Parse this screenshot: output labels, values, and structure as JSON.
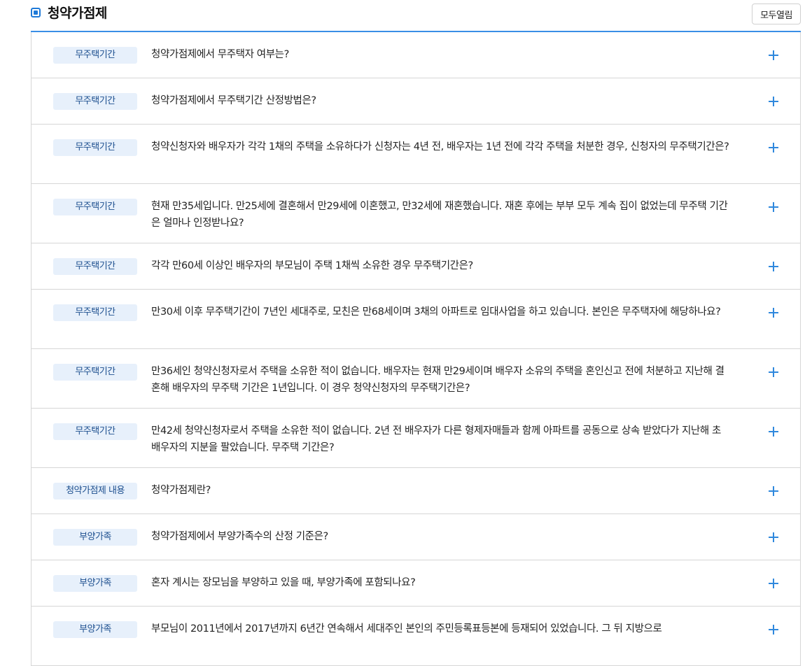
{
  "header": {
    "title": "청약가점제",
    "open_all_label": "모두열림"
  },
  "faq": [
    {
      "category": "무주택기간",
      "question": "청약가점제에서 무주택자 여부는?"
    },
    {
      "category": "무주택기간",
      "question": "청약가점제에서 무주택기간 산정방법은?"
    },
    {
      "category": "무주택기간",
      "question": "청약신청자와 배우자가 각각 1채의 주택을 소유하다가 신청자는 4년 전, 배우자는 1년 전에 각각 주택을 처분한 경우, 신청자의 무주택기간은?"
    },
    {
      "category": "무주택기간",
      "question": "현재 만35세입니다. 만25세에 결혼해서 만29세에 이혼했고, 만32세에 재혼했습니다. 재혼 후에는 부부 모두 계속 집이 없었는데 무주택 기간은 얼마나 인정받나요?"
    },
    {
      "category": "무주택기간",
      "question": "각각 만60세 이상인 배우자의 부모님이 주택 1채씩 소유한 경우 무주택기간은?"
    },
    {
      "category": "무주택기간",
      "question": "만30세 이후 무주택기간이 7년인 세대주로, 모친은 만68세이며 3채의 아파트로 임대사업을 하고 있습니다. 본인은 무주택자에 해당하나요?"
    },
    {
      "category": "무주택기간",
      "question": "만36세인 청약신청자로서 주택을 소유한 적이 없습니다. 배우자는 현재 만29세이며 배우자 소유의 주택을 혼인신고 전에 처분하고 지난해 결혼해 배우자의 무주택 기간은 1년입니다. 이 경우 청약신청자의 무주택기간은?"
    },
    {
      "category": "무주택기간",
      "question": "만42세 청약신청자로서 주택을 소유한 적이 없습니다. 2년 전 배우자가 다른 형제자매들과 함께 아파트를 공동으로 상속 받았다가 지난해 초 배우자의 지분을 팔았습니다. 무주택 기간은?"
    },
    {
      "category": "청약가점제 내용",
      "question": "청약가점제란?"
    },
    {
      "category": "부양가족",
      "question": "청약가점제에서 부양가족수의 산정 기준은?"
    },
    {
      "category": "부양가족",
      "question": "혼자 계시는 장모님을 부양하고 있을 때, 부양가족에 포함되나요?"
    },
    {
      "category": "부양가족",
      "question": "부모님이 2011년에서 2017년까지 6년간 연속해서 세대주인 본인의 주민등록표등본에 등재되어 있었습니다. 그 뒤 지방으로"
    }
  ],
  "icons": {
    "title": "checkbox-square-icon",
    "expand": "plus-icon"
  },
  "colors": {
    "accent": "#3a8ee6",
    "badge_bg": "#e7f0fb",
    "badge_text": "#1d4f8f",
    "plus": "#2f88dd"
  }
}
